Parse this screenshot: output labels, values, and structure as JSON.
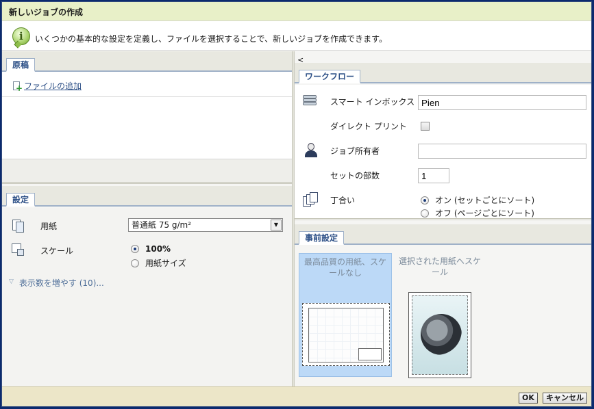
{
  "window": {
    "title": "新しいジョブの作成"
  },
  "info": {
    "text": "いくつかの基本的な設定を定義し、ファイルを選択することで、新しいジョブを作成できます。"
  },
  "original": {
    "tab": "原稿",
    "add_file": "ファイルの追加"
  },
  "settings": {
    "tab": "設定",
    "paper_label": "用紙",
    "paper_value": "普通紙 75 g/m²",
    "scale_label": "スケール",
    "scale_options": [
      "100%",
      "用紙サイズ"
    ],
    "scale_selected": "100%",
    "show_more": "表示数を増やす (10)..."
  },
  "panel": {
    "collapse_glyph": "<"
  },
  "workflow": {
    "tab": "ワークフロー",
    "smart_inbox_label": "スマート インボックス",
    "smart_inbox_value": "Pien",
    "direct_print_label": "ダイレクト プリント",
    "direct_print_checked": false,
    "owner_label": "ジョブ所有者",
    "owner_value": "",
    "copies_label": "セットの部数",
    "copies_value": "1",
    "collate_label": "丁合い",
    "collate_options": [
      "オン (セットごとにソート)",
      "オフ (ページごとにソート)"
    ],
    "collate_selected": "オン (セットごとにソート)"
  },
  "presets": {
    "tab": "事前設定",
    "items": [
      {
        "name": "最高品質の用紙、スケールなし",
        "selected": true
      },
      {
        "name": "選択された用紙へスケール",
        "selected": false
      }
    ]
  },
  "footer": {
    "ok": "OK",
    "cancel": "キャンセル"
  },
  "colors": {
    "accent": "#2c4f86",
    "selection": "#bcd9f7",
    "titlebar": "#e8f0c8"
  }
}
